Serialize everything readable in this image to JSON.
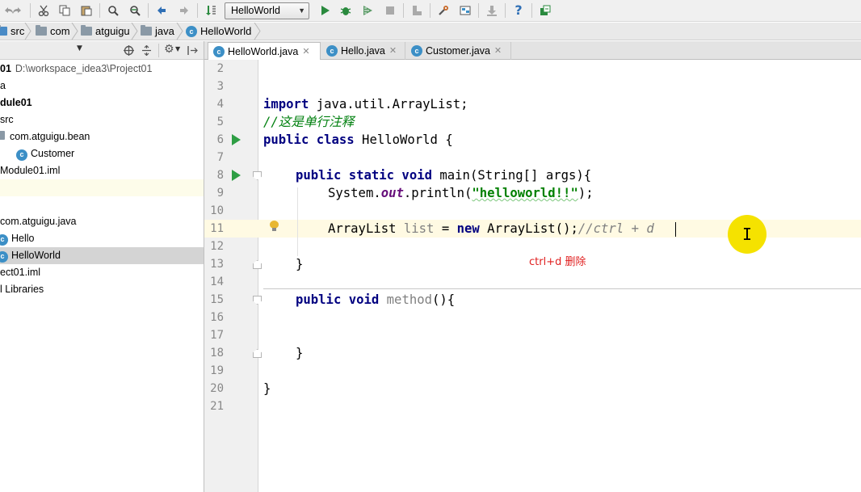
{
  "toolbar": {
    "run_config": "HelloWorld",
    "icons": [
      "redo-icon",
      "cut-icon",
      "copy-icon",
      "paste-icon",
      "find-icon",
      "replace-icon",
      "back-icon",
      "forward-icon",
      "make-icon",
      "run-icon",
      "debug-icon",
      "coverage-icon",
      "stop-icon",
      "build-icon",
      "settings-icon",
      "project-structure-icon",
      "sdk-icon",
      "help-icon",
      "update-icon"
    ]
  },
  "breadcrumb": [
    "src",
    "com",
    "atguigu",
    "java",
    "HelloWorld"
  ],
  "project_tree": [
    {
      "label": "01",
      "path": "D:\\workspace_idea3\\Project01",
      "bold": true
    },
    {
      "label": "a"
    },
    {
      "label": "dule01",
      "bold": true
    },
    {
      "label": "src"
    },
    {
      "label": "com.atguigu.bean"
    },
    {
      "label": "Customer"
    },
    {
      "label": "Module01.iml"
    },
    {
      "label": ""
    },
    {
      "label": ""
    },
    {
      "label": "com.atguigu.java"
    },
    {
      "label": "Hello"
    },
    {
      "label": "HelloWorld"
    },
    {
      "label": "ect01.iml"
    },
    {
      "label": "l Libraries"
    }
  ],
  "tabs": [
    {
      "label": "HelloWorld.java",
      "active": true
    },
    {
      "label": "Hello.java",
      "active": false
    },
    {
      "label": "Customer.java",
      "active": false
    }
  ],
  "editor": {
    "line_numbers": [
      "2",
      "3",
      "4",
      "5",
      "6",
      "7",
      "8",
      "9",
      "10",
      "11",
      "12",
      "13",
      "14",
      "15",
      "16",
      "17",
      "18",
      "19",
      "20",
      "21"
    ],
    "lines": {
      "l4_kw": "import",
      "l4_rest": " java.util.ArrayList;",
      "l5": "//这是单行注释",
      "l6_kw": "public class",
      "l6_rest": " HelloWorld {",
      "l8_kw": "public static void",
      "l8_rest": " main(String[] args){",
      "l9_a": "System.",
      "l9_b": "out",
      "l9_c": ".println(",
      "l9_str": "\"helloworld!!\"",
      "l9_d": ");",
      "l11_a": "ArrayList ",
      "l11_var": "list",
      "l11_b": " = ",
      "l11_kw": "new",
      "l11_c": " ArrayList();",
      "l11_cm": "//ctrl + d",
      "l13": "}",
      "l15_kw": "public void",
      "l15_name": " method",
      "l15_rest": "(){",
      "l18": "}",
      "l20": "}"
    },
    "annotation": "ctrl+d   删除"
  }
}
